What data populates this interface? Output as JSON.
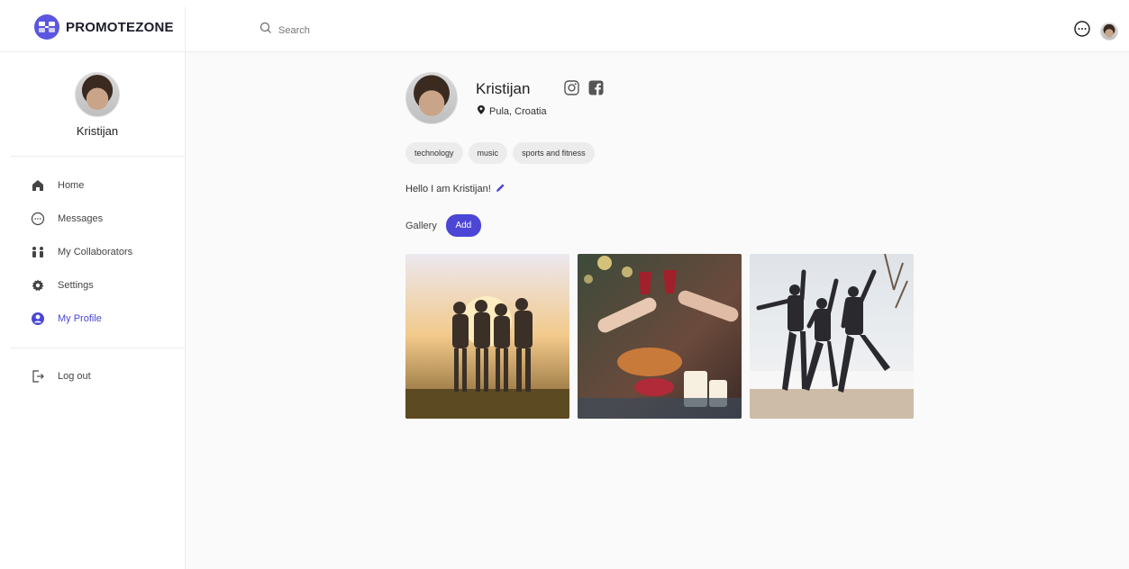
{
  "brand": {
    "name": "PROMOTEZONE"
  },
  "search": {
    "placeholder": "Search"
  },
  "sidebar": {
    "user_name": "Kristijan",
    "items": [
      {
        "label": "Home",
        "icon": "home-icon"
      },
      {
        "label": "Messages",
        "icon": "chat-icon"
      },
      {
        "label": "My Collaborators",
        "icon": "people-icon"
      },
      {
        "label": "Settings",
        "icon": "gear-icon"
      },
      {
        "label": "My Profile",
        "icon": "user-circle-icon"
      }
    ],
    "logout_label": "Log out"
  },
  "profile": {
    "name": "Kristijan",
    "location": "Pula, Croatia",
    "tags": [
      "technology",
      "music",
      "sports and fitness"
    ],
    "bio": "Hello I am Kristijan!",
    "gallery_label": "Gallery",
    "add_label": "Add"
  },
  "colors": {
    "accent": "#4b46d6",
    "active_text": "#4b46d6"
  }
}
